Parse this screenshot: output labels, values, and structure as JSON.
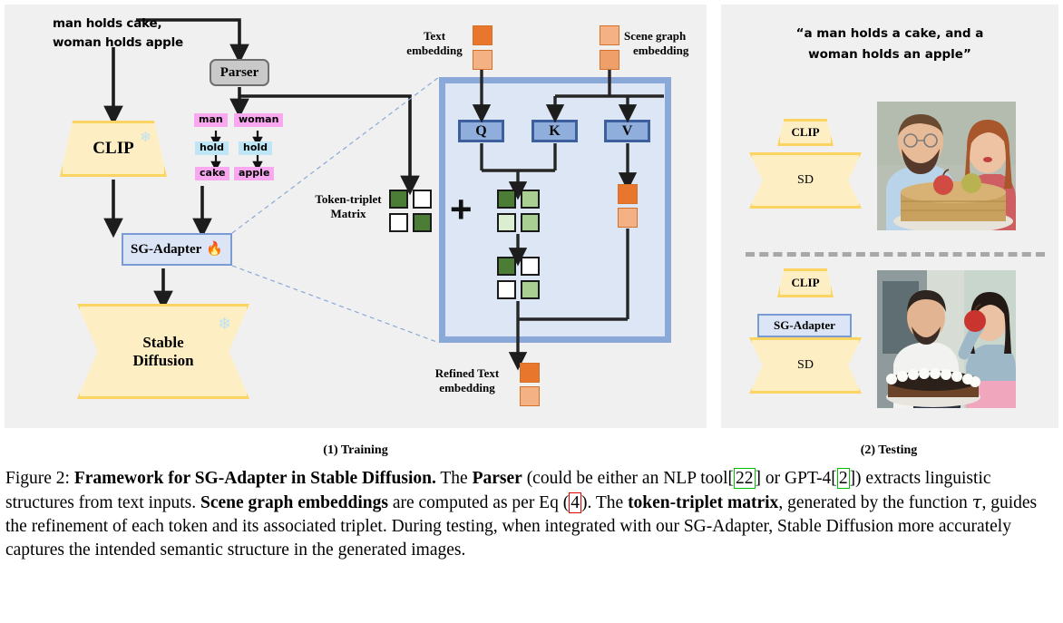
{
  "figure": {
    "number": "Figure 2",
    "subcaption_1": "(1) Training",
    "subcaption_2": "(2) Testing"
  },
  "training": {
    "input_prompt_line1": "man holds cake,",
    "input_prompt_line2": "woman holds apple",
    "parser_label": "Parser",
    "clip_label": "CLIP",
    "sg_adapter_label": "SG-Adapter",
    "stable_diffusion_line1": "Stable",
    "stable_diffusion_line2": "Diffusion",
    "frozen_icon": "snowflake-icon",
    "trainable_icon": "flame-icon",
    "scene_graph": {
      "subject_1": "man",
      "relation_1": "hold",
      "object_1": "cake",
      "subject_2": "woman",
      "relation_2": "hold",
      "object_2": "apple"
    }
  },
  "attention": {
    "text_embedding_label_l1": "Text",
    "text_embedding_label_l2": "embedding",
    "scene_graph_embedding_label_l1": "Scene graph",
    "scene_graph_embedding_label_l2": "embedding",
    "token_triplet_label_l1": "Token-triplet",
    "token_triplet_label_l2": "Matrix",
    "refined_label_l1": "Refined Text",
    "refined_label_l2": "embedding",
    "q_label": "Q",
    "k_label": "K",
    "v_label": "V",
    "plus_label": "+",
    "token_triplet_matrix": [
      [
        "dark",
        "white"
      ],
      [
        "white",
        "dark"
      ]
    ],
    "attention_matrix": [
      [
        "dark",
        "mid"
      ],
      [
        "pale",
        "mid"
      ]
    ],
    "refined_matrix": [
      [
        "dark",
        "white"
      ],
      [
        "white",
        "mid"
      ]
    ]
  },
  "testing": {
    "prompt_line1": "“a man holds a cake, and a",
    "prompt_line2": "woman holds an apple”",
    "top_row": {
      "clip_label": "CLIP",
      "sd_label": "SD"
    },
    "bottom_row": {
      "clip_label": "CLIP",
      "sg_adapter_label": "SG-Adapter",
      "sd_label": "SD"
    }
  },
  "caption": {
    "prefix": "Figure 2: ",
    "bold_1": "Framework for SG-Adapter in Stable Diffusion.",
    "t1": " The ",
    "bold_2": "Parser",
    "t2": " (could be either an NLP tool[",
    "cite_1": "22",
    "t3": "] or GPT-4[",
    "cite_2": "2",
    "t4": "]) extracts linguistic structures from text inputs. ",
    "bold_3": "Scene graph embeddings",
    "t5": " are computed as per Eq (",
    "cite_eq": "4",
    "t6": "). The ",
    "bold_4": "token-triplet matrix",
    "t7": ", generated by the function ",
    "tau": "τ",
    "t8": ", guides the refinement of each token and its associated triplet. During testing, when integrated with our SG-Adapter, Stable Diffusion more accurately captures the intended semantic structure in the generated images."
  },
  "colors": {
    "panel_bg": "#f0f0f0",
    "trapezoid_fill": "#fdeec4",
    "trapezoid_border": "#fcd462",
    "adapter_fill": "#dbe5f5",
    "adapter_border": "#7a9ad4",
    "attention_outer": "#8aa8d8",
    "attention_inner": "#dce6f4",
    "qkv_fill": "#8faedb",
    "qkv_border": "#3e5f9e",
    "embed_dark": "#e8762c",
    "embed_light": "#f4b183",
    "matrix_dark_green": "#4b7d37",
    "matrix_mid_green": "#a9cf92",
    "matrix_pale_green": "#dceed2",
    "object_node": "#f9a8f0",
    "relation_node": "#bfe6f5",
    "cite_box": "#00c000",
    "eq_box": "#e00000"
  }
}
